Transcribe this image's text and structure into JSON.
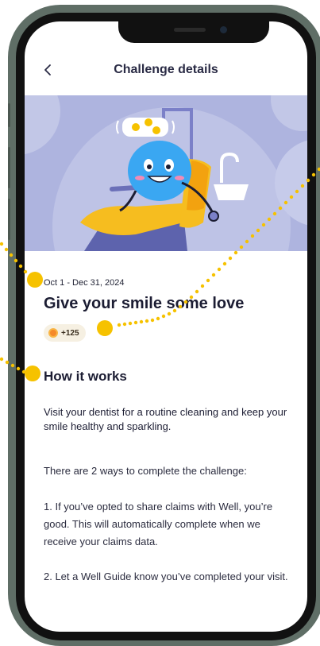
{
  "header": {
    "title": "Challenge details",
    "back_icon": "chevron-left-icon"
  },
  "hero": {
    "alt_subject": "smiling tooth in dental chair",
    "colors": {
      "background": "#aeb4df",
      "tooth": "#3aa7f2",
      "chair": "#f6bd1f",
      "lamp": "#7b80c8"
    }
  },
  "challenge": {
    "date_range": "Oct 1 - Dec 31, 2024",
    "title": "Give your smile some love",
    "points": "+125",
    "points_icon": "coin-icon"
  },
  "how_it_works": {
    "heading": "How it works",
    "intro": "Visit your dentist for a routine cleaning and keep your smile healthy and sparkling.",
    "ways_intro": "There are 2 ways to complete the challenge:",
    "way_1": "1. If you’ve opted to share claims with Well, you’re good. This will automatically complete when we receive your claims data.",
    "way_2": "2. Let a Well Guide know you’ve completed your visit."
  },
  "theme": {
    "accent": "#f6c200",
    "phone_frame": "#5f6e66",
    "text": "#1c1d33"
  }
}
